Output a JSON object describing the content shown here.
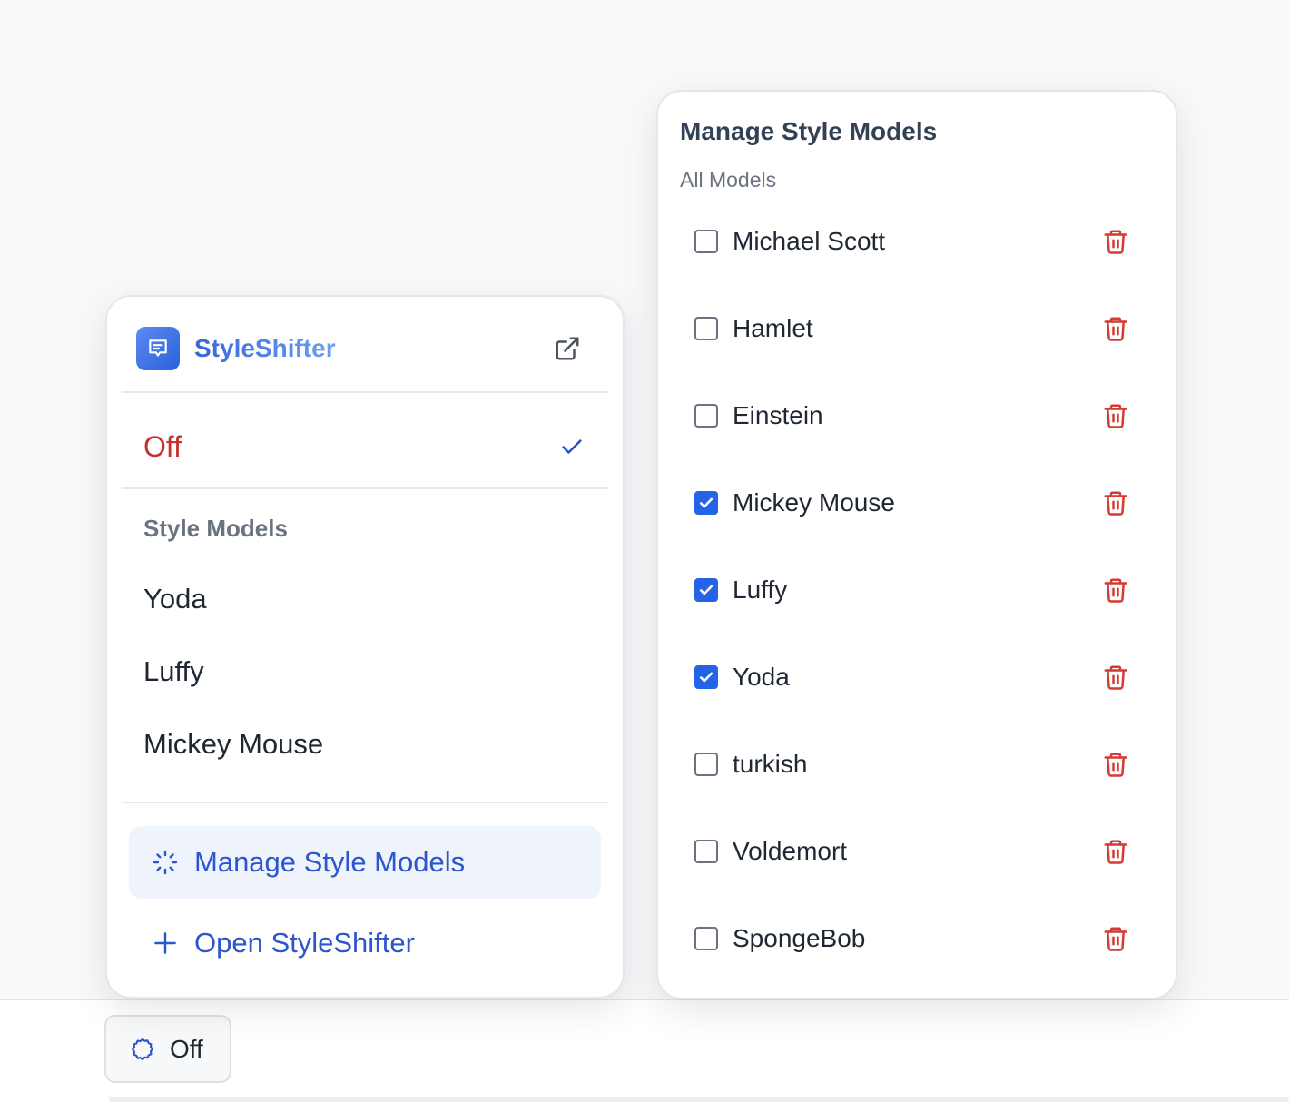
{
  "popup": {
    "app_name": "StyleShifter",
    "off_label": "Off",
    "section_title": "Style Models",
    "models": [
      "Yoda",
      "Luffy",
      "Mickey Mouse"
    ],
    "manage_label": "Manage Style Models",
    "open_label": "Open StyleShifter"
  },
  "manage_panel": {
    "title": "Manage Style Models",
    "subtitle": "All Models",
    "models": [
      {
        "name": "Michael Scott",
        "checked": false
      },
      {
        "name": "Hamlet",
        "checked": false
      },
      {
        "name": "Einstein",
        "checked": false
      },
      {
        "name": "Mickey Mouse",
        "checked": true
      },
      {
        "name": "Luffy",
        "checked": true
      },
      {
        "name": "Yoda",
        "checked": true
      },
      {
        "name": "turkish",
        "checked": false
      },
      {
        "name": "Voldemort",
        "checked": false
      },
      {
        "name": "SpongeBob",
        "checked": false
      }
    ]
  },
  "status_button": {
    "label": "Off"
  },
  "colors": {
    "accent": "#2463e6",
    "off_red": "#c5302a",
    "trash_red": "#d63a32"
  },
  "icons": [
    "app-logo-icon",
    "external-link-icon",
    "checkmark-icon",
    "loader-icon",
    "plus-icon",
    "trash-icon",
    "gear-icon"
  ]
}
